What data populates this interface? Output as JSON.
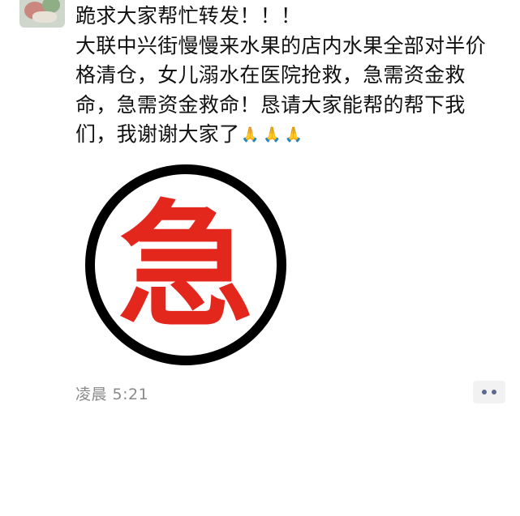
{
  "post": {
    "lines": [
      "跪求大家帮忙转发！！！",
      "大联中兴街慢慢来水果的店内水果全部对半价",
      "格清仓，女儿溺水在医院抢救，急需资金救",
      "命，急需资金救命！恳请大家能帮的帮下我",
      "们，我谢谢大家了"
    ],
    "emoji": [
      "🙏",
      "🙏",
      "🙏"
    ],
    "image": {
      "character": "急",
      "ring_color": "#000000",
      "character_color": "#e3271d"
    },
    "timestamp": "凌晨 5:21",
    "more_icon": "ellipsis-icon"
  }
}
